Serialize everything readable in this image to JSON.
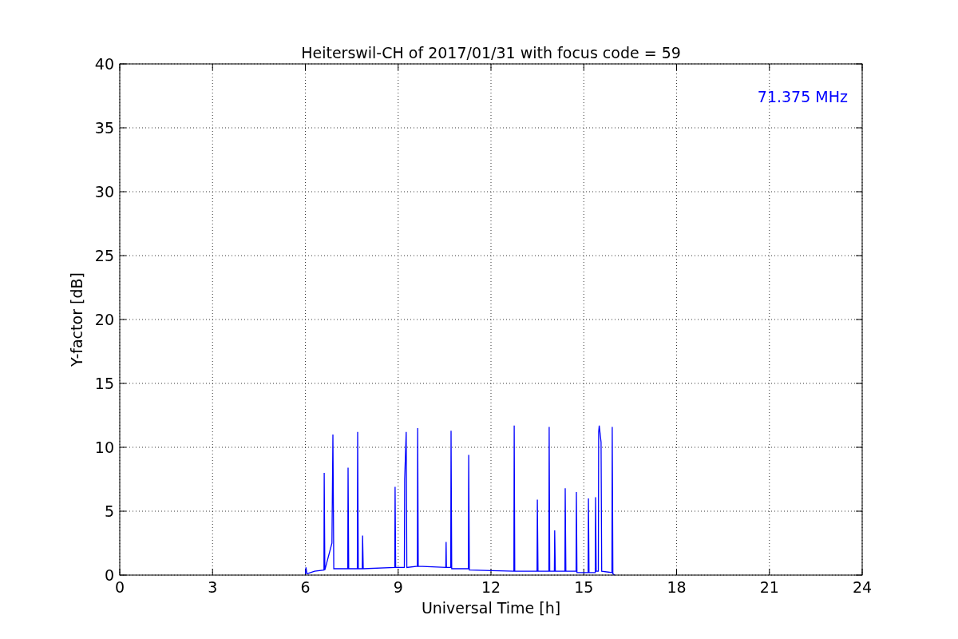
{
  "chart_data": {
    "type": "line",
    "title": "Heiterswil-CH of 2017/01/31 with focus code = 59",
    "xlabel": "Universal Time [h]",
    "ylabel": "Y-factor [dB]",
    "x": [
      6.0,
      6.02,
      6.05,
      6.3,
      6.6,
      6.61,
      6.63,
      6.86,
      6.89,
      6.92,
      7.37,
      7.38,
      7.4,
      7.68,
      7.69,
      7.71,
      7.84,
      7.85,
      7.87,
      8.89,
      8.9,
      8.92,
      9.2,
      9.21,
      9.26,
      9.28,
      9.62,
      9.63,
      9.65,
      10.54,
      10.55,
      10.56,
      10.7,
      10.71,
      10.73,
      11.27,
      11.28,
      11.3,
      12.74,
      12.75,
      12.77,
      13.49,
      13.5,
      13.52,
      13.87,
      13.88,
      13.9,
      14.05,
      14.06,
      14.08,
      14.39,
      14.4,
      14.42,
      14.75,
      14.76,
      14.78,
      15.14,
      15.15,
      15.17,
      15.37,
      15.38,
      15.4,
      15.47,
      15.48,
      15.5,
      15.56,
      15.58,
      15.91,
      15.92,
      15.94,
      16.0
    ],
    "grid": true,
    "series": [
      {
        "color": "#0000ff",
        "values": [
          0.1,
          0.6,
          0.1,
          0.3,
          0.4,
          8.0,
          0.4,
          2.5,
          11.0,
          0.5,
          0.5,
          8.4,
          0.5,
          0.5,
          11.2,
          0.5,
          0.5,
          3.1,
          0.5,
          0.6,
          6.9,
          0.6,
          0.6,
          7.5,
          11.2,
          0.6,
          0.7,
          11.5,
          0.7,
          0.6,
          2.6,
          0.6,
          0.6,
          11.3,
          0.5,
          0.5,
          9.4,
          0.4,
          0.3,
          11.7,
          0.3,
          0.3,
          5.9,
          0.3,
          0.3,
          11.6,
          0.3,
          0.3,
          3.5,
          0.3,
          0.3,
          6.8,
          0.3,
          0.3,
          6.5,
          0.2,
          0.2,
          6.0,
          0.2,
          0.2,
          6.1,
          0.3,
          0.3,
          11.2,
          11.7,
          10.4,
          0.3,
          0.2,
          11.6,
          0.1,
          0.0
        ]
      }
    ],
    "xlim": [
      0,
      24
    ],
    "ylim": [
      0,
      40
    ],
    "xticks": [
      0,
      3,
      6,
      9,
      12,
      15,
      18,
      21,
      24
    ],
    "yticks": [
      0,
      5,
      10,
      15,
      20,
      25,
      30,
      35,
      40
    ],
    "annotations": [
      "71.375 MHz"
    ]
  }
}
